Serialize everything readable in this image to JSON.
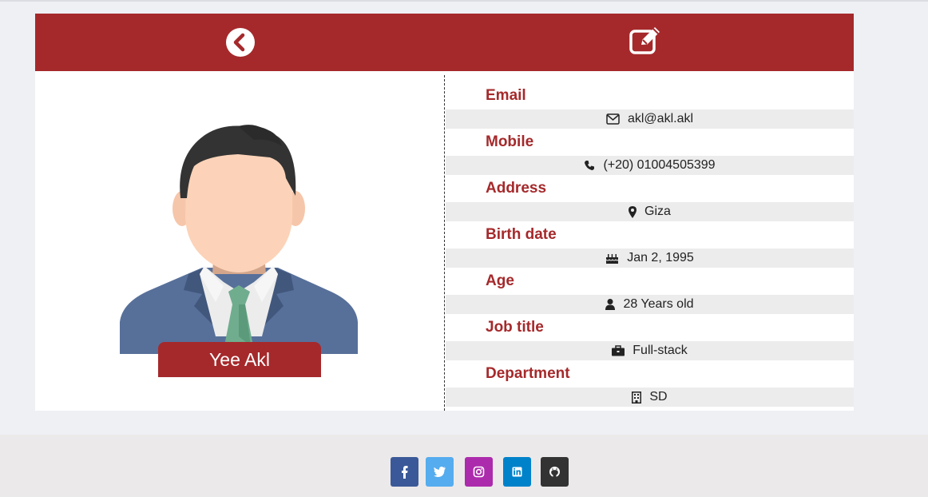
{
  "header": {
    "back_icon": "chevron-left-circle-icon",
    "edit_icon": "edit-square-icon",
    "color": "#a5292b"
  },
  "profile": {
    "name": "Yee Akl"
  },
  "fields": [
    {
      "label": "Email",
      "value": "akl@akl.akl",
      "icon": "envelope-icon"
    },
    {
      "label": "Mobile",
      "value": "(+20) 01004505399",
      "icon": "phone-icon"
    },
    {
      "label": "Address",
      "value": "Giza",
      "icon": "map-marker-icon"
    },
    {
      "label": "Birth date",
      "value": "Jan 2, 1995",
      "icon": "birthday-cake-icon"
    },
    {
      "label": "Age",
      "value": "28 Years old",
      "icon": "user-icon"
    },
    {
      "label": "Job title",
      "value": "Full-stack",
      "icon": "briefcase-icon"
    },
    {
      "label": "Department",
      "value": "SD",
      "icon": "building-icon"
    }
  ],
  "footer": {
    "socials": [
      {
        "name": "facebook",
        "color": "#3b5998"
      },
      {
        "name": "twitter",
        "color": "#55acee"
      },
      {
        "name": "instagram",
        "color": "#ac2bac"
      },
      {
        "name": "linkedin",
        "color": "#0082ca"
      },
      {
        "name": "github",
        "color": "#333333"
      }
    ]
  }
}
